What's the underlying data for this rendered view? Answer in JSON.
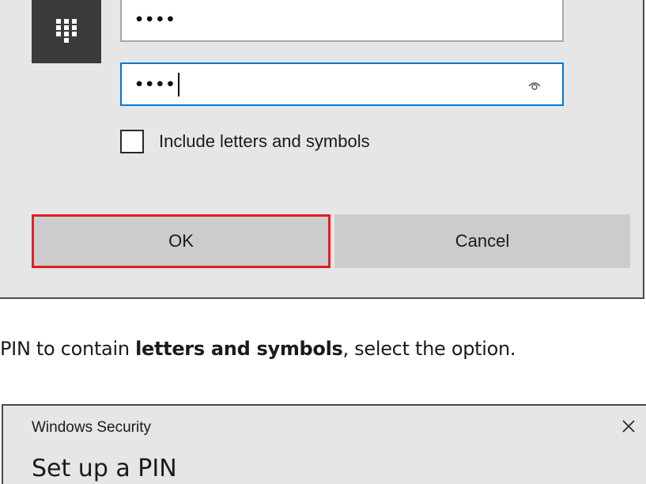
{
  "top_dialog": {
    "pin_field_1": {
      "value": "••••"
    },
    "pin_field_2": {
      "value": "••••"
    },
    "checkbox": {
      "label": "Include letters and symbols",
      "checked": false
    },
    "buttons": {
      "ok_label": "OK",
      "cancel_label": "Cancel"
    },
    "icons": {
      "tile": "keypad-icon",
      "reveal": "eye-icon"
    }
  },
  "instruction": {
    "prefix": "PIN to contain ",
    "bold": "letters and symbols",
    "suffix": ", select the option."
  },
  "bottom_dialog": {
    "window_title": "Windows Security",
    "heading": "Set up a PIN",
    "close_icon": "close-icon"
  },
  "colors": {
    "dialog_bg": "#e6e6e6",
    "focus_border": "#0078d7",
    "highlight_border": "#e01e25",
    "keypad_tile": "#3b3b3b",
    "button_bg": "#cccccc"
  }
}
